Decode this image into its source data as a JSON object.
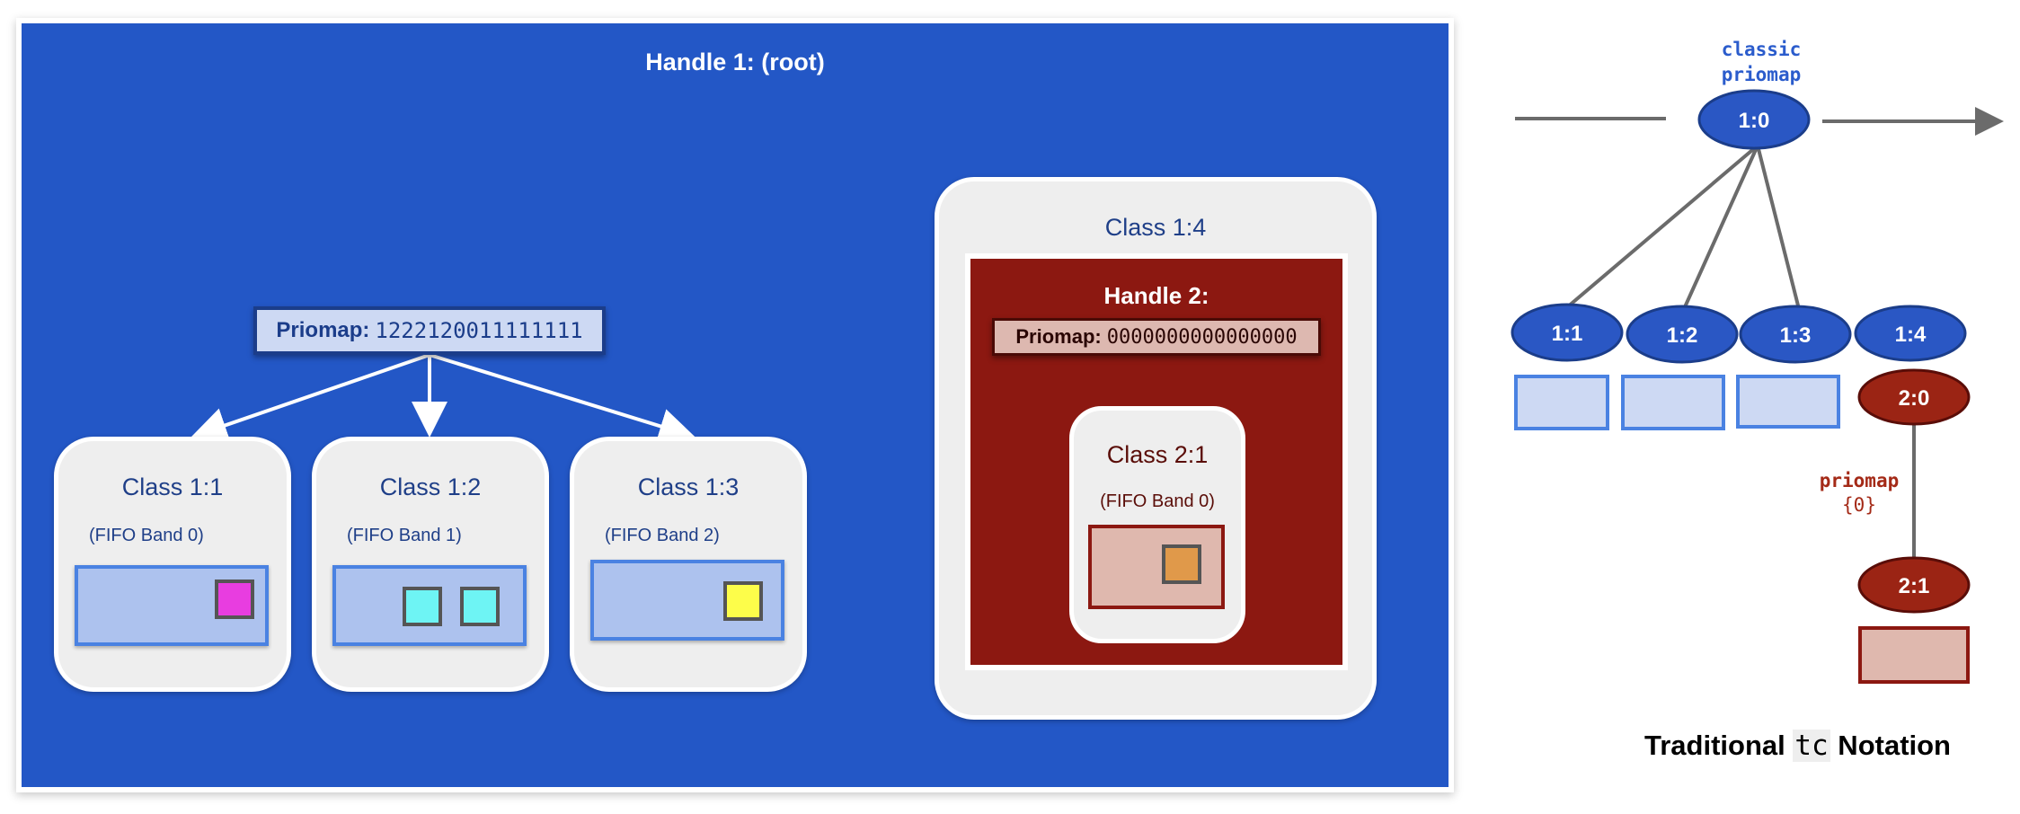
{
  "root": {
    "title": "Handle 1: (root)"
  },
  "root_priomap": {
    "label": "Priomap:",
    "value": "1222120011111111"
  },
  "classes": [
    {
      "title": "Class 1:1",
      "band": "(FIFO Band 0)",
      "packets": [
        "#e83de0"
      ]
    },
    {
      "title": "Class 1:2",
      "band": "(FIFO Band 1)",
      "packets": [
        "#6ef4f4",
        "#6ef4f4"
      ]
    },
    {
      "title": "Class 1:3",
      "band": "(FIFO Band 2)",
      "packets": [
        "#fdfd4a"
      ]
    }
  ],
  "class14": {
    "title": "Class 1:4",
    "handle": {
      "title": "Handle 2:",
      "priomap_label": "Priomap:",
      "priomap_value": "0000000000000000"
    },
    "child": {
      "title": "Class 2:1",
      "band": "(FIFO Band 0)",
      "packet_color": "#e0994a"
    }
  },
  "tree": {
    "root": "1:0",
    "root_note": [
      "classic",
      "priomap"
    ],
    "children": [
      "1:1",
      "1:2",
      "1:3",
      "1:4"
    ],
    "handle2": "2:0",
    "handle2_note": [
      "priomap",
      "{0}"
    ],
    "leaf": "2:1",
    "title_pre": "Traditional ",
    "title_code": "tc",
    "title_post": " Notation"
  },
  "colors": {
    "root_blue": "#2357c6",
    "handle2_red": "#8c1811",
    "node_blue": "#2a57c4",
    "node_red": "#9b2414",
    "note_blue": "#2b5ccc",
    "note_red": "#a42a17"
  }
}
